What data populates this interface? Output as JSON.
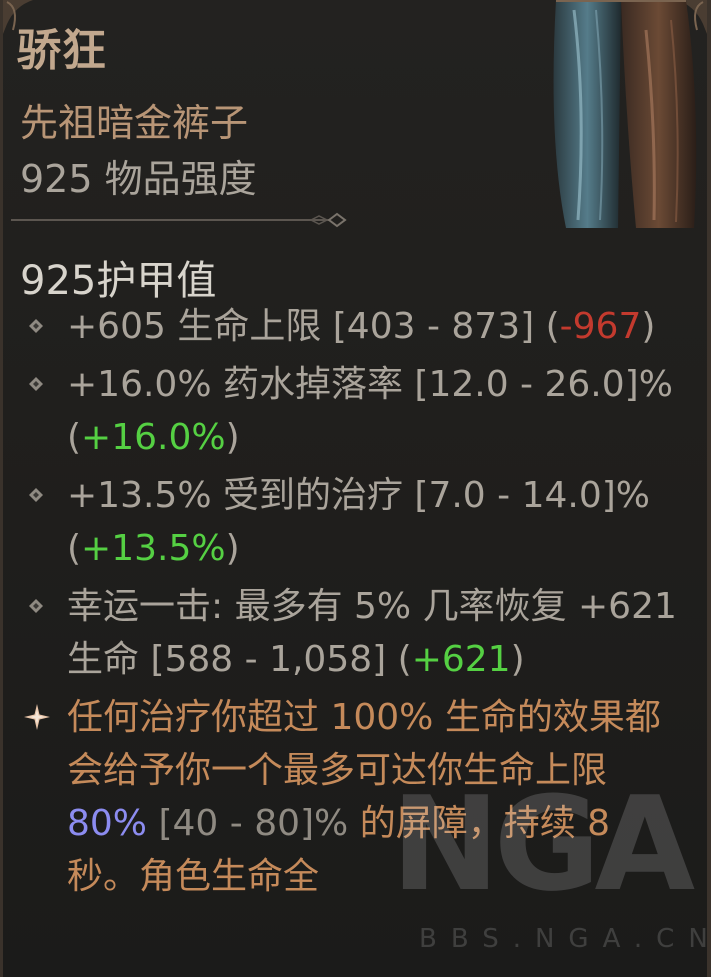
{
  "item": {
    "name": "骄狂",
    "type": "先祖暗金裤子",
    "power": "925 物品强度",
    "armor": "925护甲值"
  },
  "affixes": [
    {
      "icon": "diamond-bullet-icon",
      "text": "+605 生命上限 [403 - 873] (",
      "delta": "-967",
      "close": ")"
    },
    {
      "icon": "diamond-bullet-icon",
      "text": "+16.0% 药水掉落率 [12.0 - 26.0]% (",
      "delta": "+16.0%",
      "close": ")"
    },
    {
      "icon": "diamond-bullet-icon",
      "text": "+13.5% 受到的治疗 [7.0 - 14.0]% (",
      "delta": "+13.5%",
      "close": ")"
    },
    {
      "icon": "diamond-bullet-icon",
      "text": "幸运一击: 最多有 5% 几率恢复 +621 生命 [588 - 1,058] (",
      "delta": "+621",
      "close": ")"
    }
  ],
  "unique_power": {
    "icon": "sparkle-star-icon",
    "part1": "任何治疗你超过 ",
    "part2": "100%",
    "part3": " 生命的效果都会给予你一个最多可达你生命上限 ",
    "part4": "80%",
    "part5": " [40 - 80]%",
    "part6": " 的屏障，持续 8 秒。角色生命全"
  },
  "watermark": {
    "logo": "NGA",
    "site": "BBS.NGA.CN"
  },
  "colors": {
    "name": "#c2a88e",
    "negative": "#c33a2e",
    "positive": "#55d043",
    "unique": "#c58a5a",
    "highlight_blue": "#8c8cf0"
  }
}
